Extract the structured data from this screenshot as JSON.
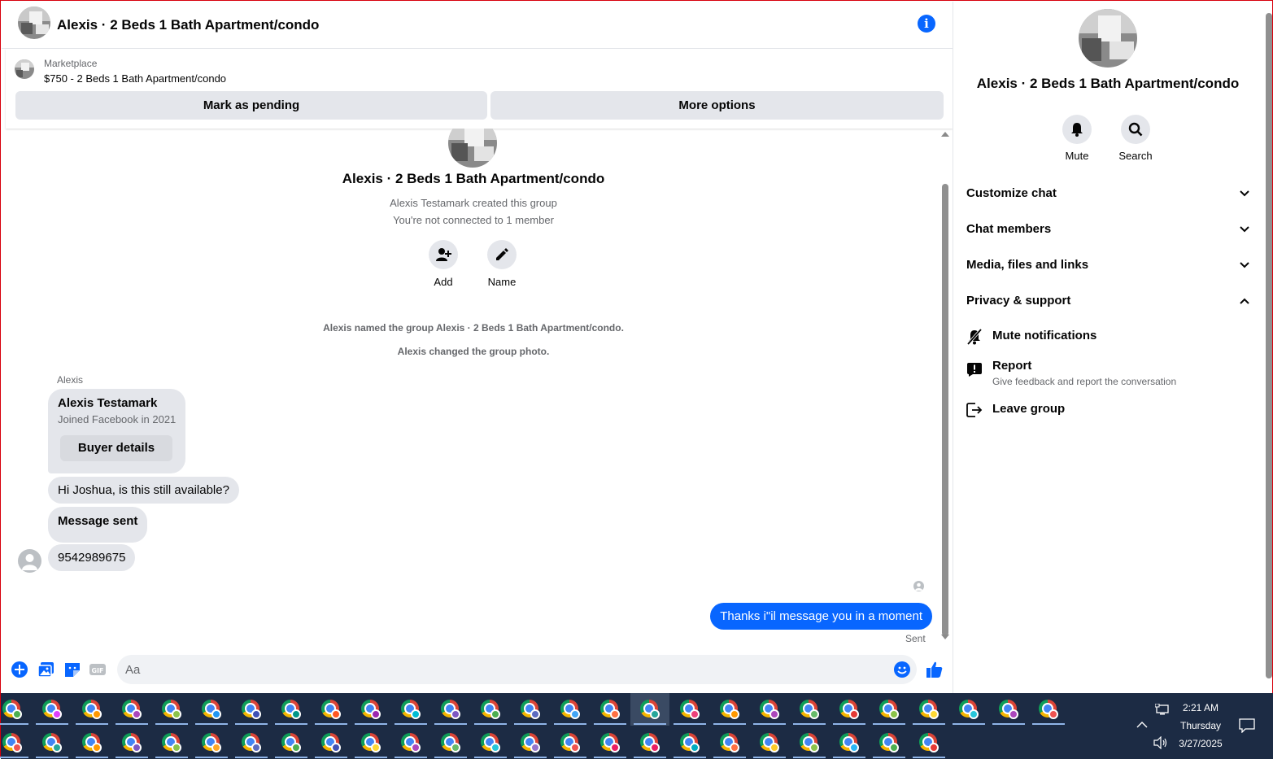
{
  "colors": {
    "accent": "#0866ff",
    "bubble_in": "#e4e6eb",
    "muted_text": "#65676b",
    "taskbar": "#1c2b44"
  },
  "header": {
    "title": "Alexis · 2 Beds 1 Bath Apartment/condo",
    "info_icon": "info-icon"
  },
  "marketplace": {
    "label": "Marketplace",
    "listing": "$750 - 2 Beds 1 Bath Apartment/condo",
    "mark_pending": "Mark as pending",
    "more_options": "More options"
  },
  "thread": {
    "group_title": "Alexis · 2 Beds 1 Bath Apartment/condo",
    "created_by": "Alexis Testamark created this group",
    "not_connected": "You're not connected to 1 member",
    "add_label": "Add",
    "name_label": "Name",
    "sys_named": "Alexis named the group Alexis · 2 Beds 1 Bath Apartment/condo.",
    "sys_photo": "Alexis changed the group photo.",
    "sender": "Alexis",
    "card_name": "Alexis Testamark",
    "card_joined": "Joined Facebook in 2021",
    "card_button": "Buyer details",
    "msg1": "Hi Joshua, is this still available?",
    "msg2": "Message sent",
    "msg3": "9542989675",
    "out_msg": "Thanks i\"il message you in a moment",
    "sent_status": "Sent"
  },
  "composer": {
    "placeholder": "Aa"
  },
  "side": {
    "title": "Alexis · 2 Beds 1 Bath Apartment/condo",
    "mute": "Mute",
    "search": "Search",
    "sections": [
      "Customize chat",
      "Chat members",
      "Media, files and links",
      "Privacy & support"
    ],
    "mute_notifications": "Mute notifications",
    "report": "Report",
    "report_desc": "Give feedback and report the conversation",
    "leave_group": "Leave group"
  },
  "taskbar": {
    "time": "2:21 AM",
    "day": "Thursday",
    "date": "3/27/2025",
    "row1_profile_colors": [
      "#4caf50",
      "#e040fb",
      "#ff9800",
      "#ab47bc",
      "#8bc34a",
      "#2196f3",
      "#3f51b5",
      "#009688",
      "#ff5722",
      "#9c27b0",
      "#00bcd4",
      "#7e57c2",
      "#4caf50",
      "#5c6bc0",
      "#42a5f5",
      "#ff7043",
      "#26a69a",
      "#ec407a",
      "#ff9800",
      "#ab47bc",
      "#66bb6a",
      "#e53935",
      "#8bc34a",
      "#fdd835",
      "#26c6da",
      "#ab47bc",
      "#ef5350"
    ],
    "row2_profile_colors": [
      "#ef5350",
      "#26a69a",
      "#ff9800",
      "#7e57c2",
      "#8bc34a",
      "#ffa726",
      "#5c6bc0",
      "#4caf50",
      "#3f51b5",
      "#fdd835",
      "#ab47bc",
      "#66bb6a",
      "#26c6da",
      "#9575cd",
      "#ef5350",
      "#e91e63",
      "#e91e63",
      "#00acc1",
      "#ff7043",
      "#ffca28",
      "#8bc34a",
      "#29b6f6",
      "#4caf50",
      "#e53935"
    ]
  }
}
